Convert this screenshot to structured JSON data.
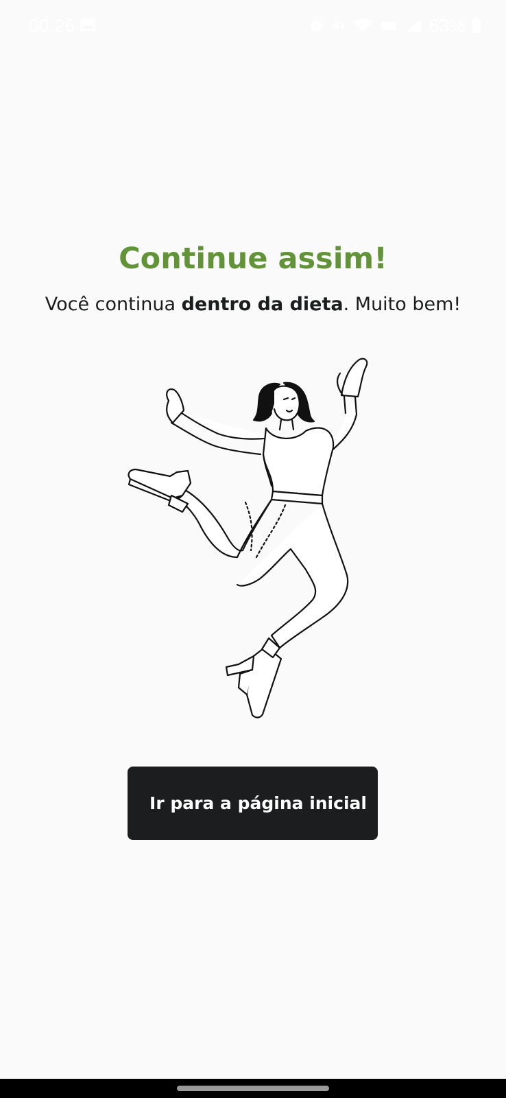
{
  "status_bar": {
    "time": "00:26",
    "battery": "63%",
    "icons": [
      "gallery-icon",
      "alarm-icon",
      "mute-icon",
      "wifi-icon",
      "volte-icon",
      "signal-icon",
      "battery-icon"
    ]
  },
  "main": {
    "title": "Continue assim!",
    "subtitle_before": "Você continua ",
    "subtitle_bold": "dentro da dieta",
    "subtitle_after": ". Muito bem!",
    "illustration": "jumping-woman-illustration"
  },
  "actions": {
    "home_button_label": "Ir para a página inicial"
  },
  "colors": {
    "title": "#639339",
    "text": "#1b1d1e",
    "button_bg": "#1b1d1e",
    "button_text": "#ffffff",
    "background": "#fafafa"
  }
}
